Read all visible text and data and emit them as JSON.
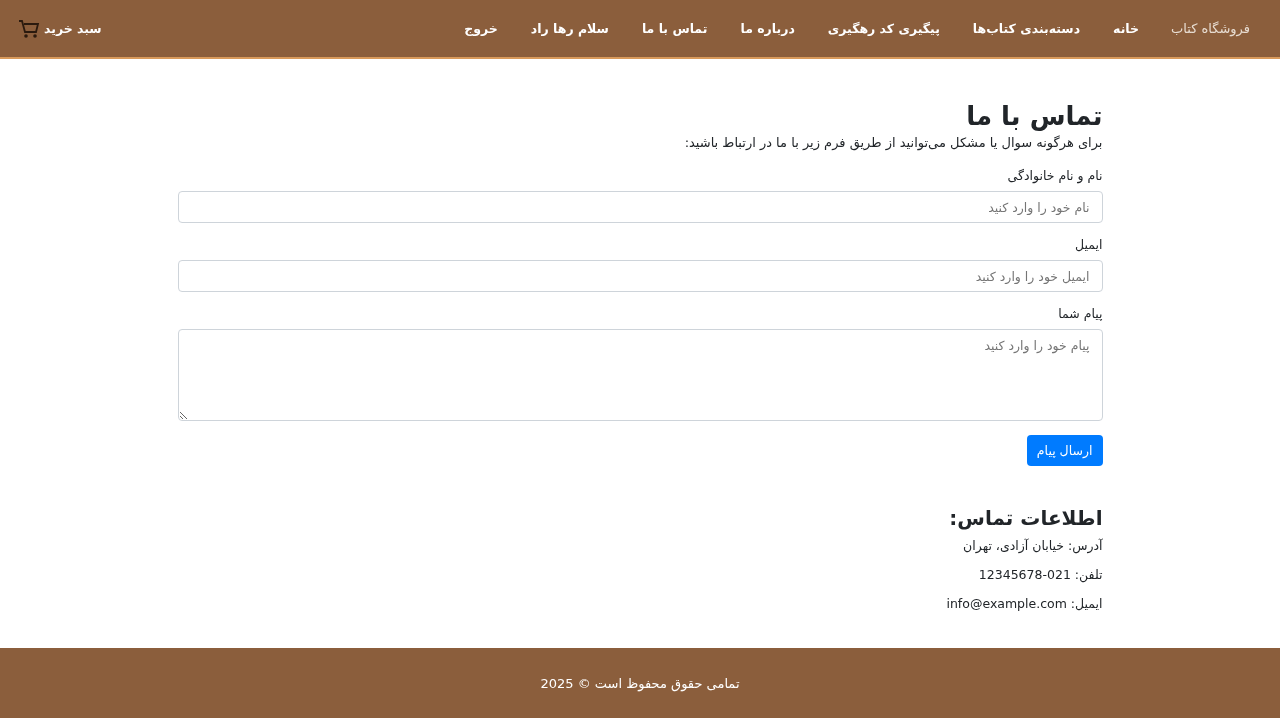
{
  "navbar": {
    "brand": "فروشگاه کتاب",
    "links": [
      "خانه",
      "دسته‌بندی کتاب‌ها",
      "پیگیری کد رهگیری",
      "درباره ما",
      "تماس با ما",
      "سلام رها راد",
      "خروج"
    ],
    "cart": "سبد خرید"
  },
  "title": "تماس با ما",
  "intro": "برای هرگونه سوال یا مشکل می‌توانید از طریق فرم زیر با ما در ارتباط باشید:",
  "fields": [
    {
      "kind": "input",
      "label": "نام و نام خانوادگی",
      "placeholder": "نام خود را وارد کنید"
    },
    {
      "kind": "input",
      "label": "ایمیل",
      "placeholder": "ایمیل خود را وارد کنید"
    },
    {
      "kind": "textarea",
      "label": "پیام شما",
      "placeholder": "پیام خود را وارد کنید"
    }
  ],
  "submit": "ارسال پیام",
  "contact": {
    "title": "اطلاعات تماس:",
    "lines": [
      "آدرس: خیابان آزادی، تهران",
      "تلفن: 021-12345678",
      "ایمیل: info@example.com"
    ]
  },
  "footer": "تمامی حقوق محفوظ است © 2025"
}
